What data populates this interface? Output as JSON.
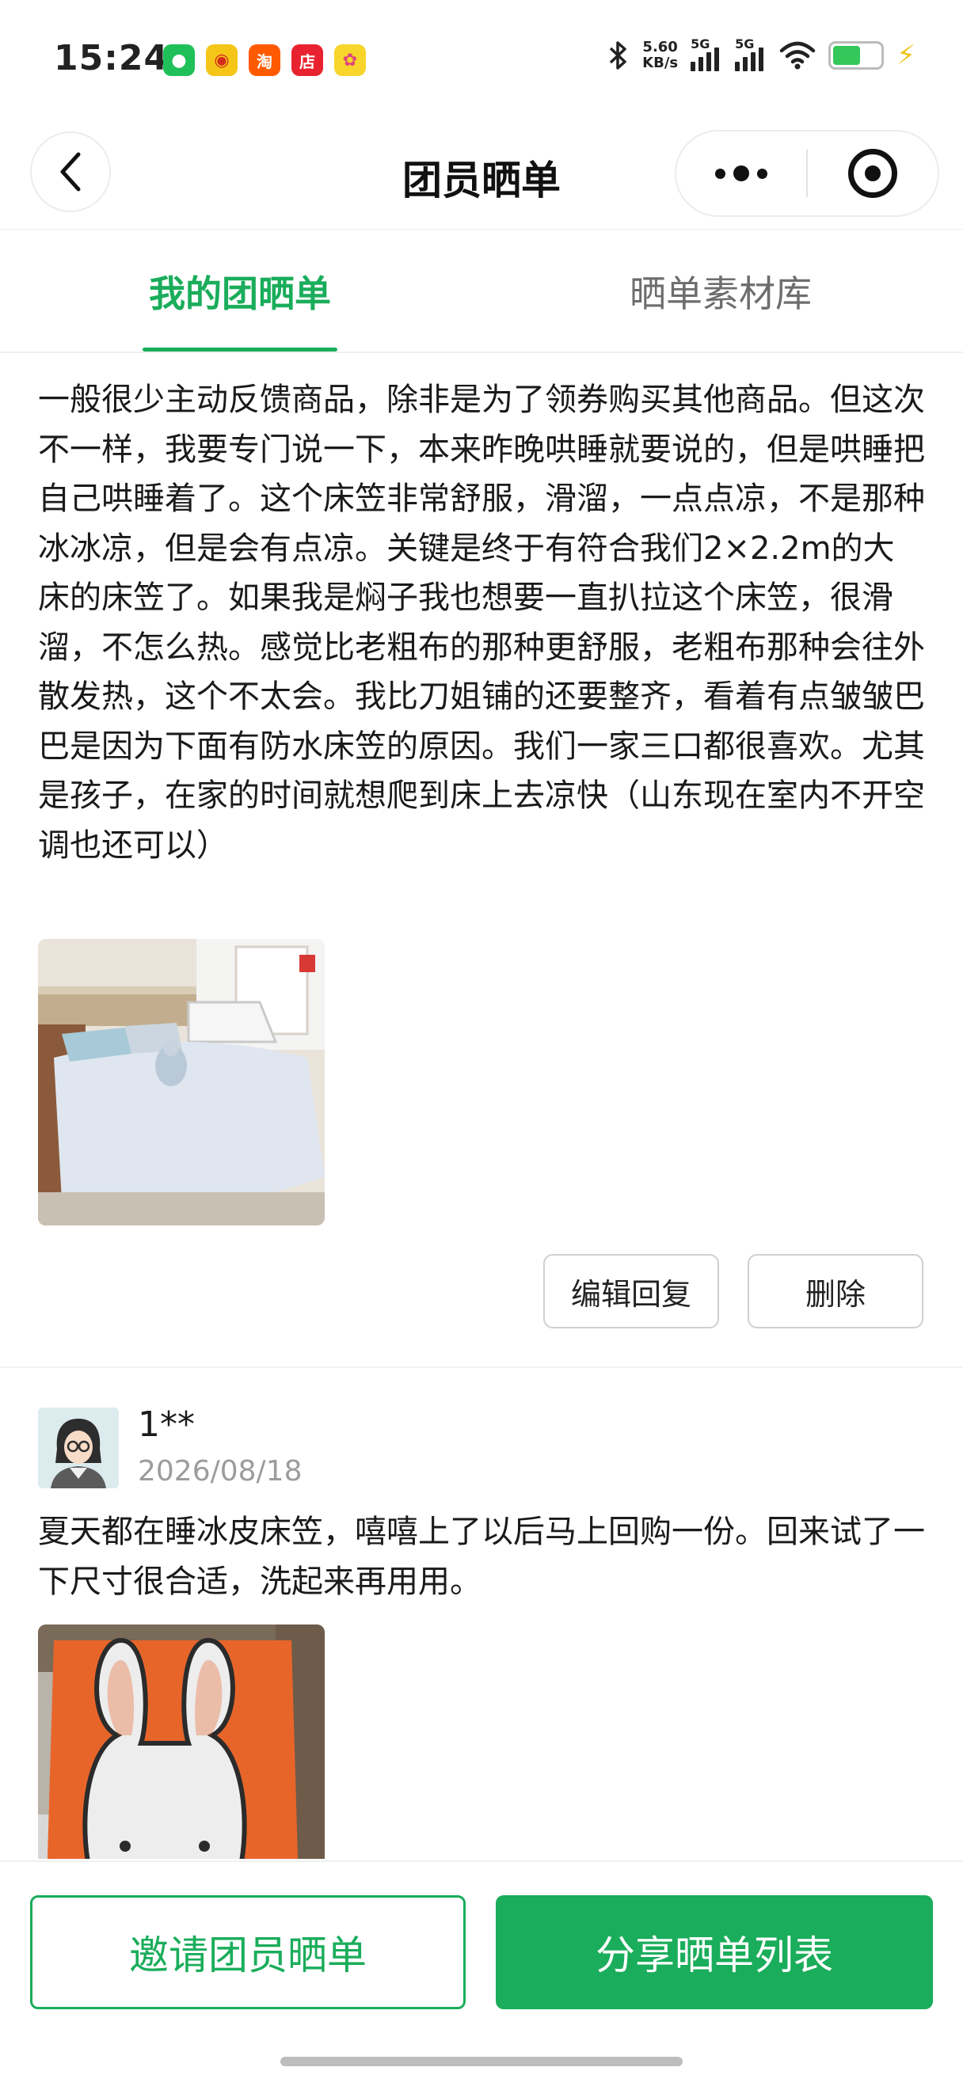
{
  "status_bar": {
    "time": "15:24",
    "net_speed_value": "5.60",
    "net_speed_unit": "KB/s",
    "signal_1_label": "5G",
    "signal_2_label": "5G",
    "app_icons": [
      "wechat-icon",
      "weibo-icon",
      "taobao-icon",
      "store-icon",
      "flower-app-icon"
    ],
    "app_icon_glyphs": [
      "●",
      "◉",
      "淘",
      "店",
      "✿"
    ],
    "battery_level": 0.58,
    "charging": true
  },
  "nav": {
    "title": "团员晒单",
    "more_icon": "more-dots-icon",
    "close_icon": "target-circle-icon"
  },
  "tabs": [
    {
      "label": "我的团晒单",
      "active": true
    },
    {
      "label": "晒单素材库",
      "active": false
    }
  ],
  "reviews": [
    {
      "text": "一般很少主动反馈商品，除非是为了领券购买其他商品。但这次不一样，我要专门说一下，本来昨晚哄睡就要说的，但是哄睡把自己哄睡着了。这个床笠非常舒服，滑溜，一点点凉，不是那种冰冰凉，但是会有点凉。关键是终于有符合我们2×2.2m的大床的床笠了。如果我是焖子我也想要一直扒拉这个床笠，很滑溜，不怎么热。感觉比老粗布的那种更舒服，老粗布那种会往外散发热，这个不太会。我比刀姐铺的还要整齐，看着有点皱皱巴巴是因为下面有防水床笠的原因。我们一家三口都很喜欢。尤其是孩子，在家的时间就想爬到床上去凉快（山东现在室内不开空调也还可以）",
      "edit_label": "编辑回复",
      "delete_label": "删除"
    },
    {
      "user_name": "1**",
      "date": "2026/08/18",
      "text": "夏天都在睡冰皮床笠，嘻嘻上了以后马上回购一份。回来试了一下尺寸很合适，洗起来再用用。"
    }
  ],
  "bottom": {
    "invite_label": "邀请团员晒单",
    "share_label": "分享晒单列表"
  },
  "colors": {
    "accent": "#1aad5b",
    "text": "#1a1a1a",
    "muted": "#9c9c9c"
  }
}
